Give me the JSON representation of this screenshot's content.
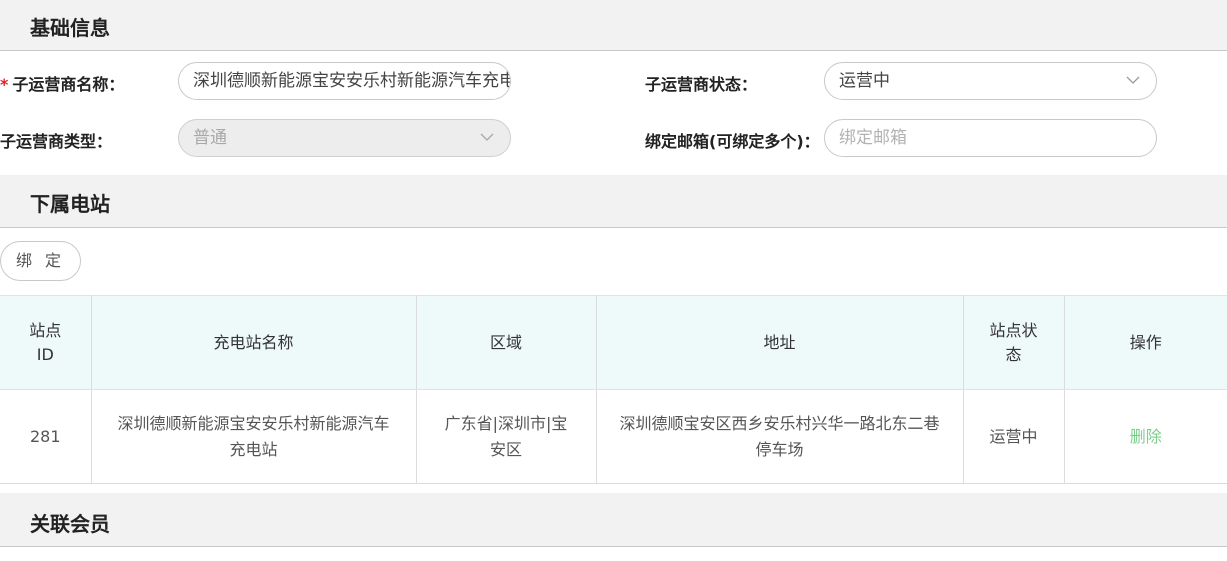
{
  "sections": {
    "basic_info": "基础信息",
    "sub_stations": "下属电站",
    "linked_members": "关联会员"
  },
  "form": {
    "required_mark": "*",
    "name_label": "子运营商名称：",
    "name_value": "深圳德顺新能源宝安安乐村新能源汽车充电站",
    "status_label": "子运营商状态：",
    "status_value": "运营中",
    "type_label": "子运营商类型：",
    "type_value": "普通",
    "email_label": "绑定邮箱(可绑定多个)：",
    "email_placeholder": "绑定邮箱"
  },
  "bind_button": "绑 定",
  "table": {
    "headers": {
      "id": "站点ID",
      "name": "充电站名称",
      "region": "区域",
      "address": "地址",
      "status": "站点状态",
      "action": "操作"
    },
    "rows": [
      {
        "id": "281",
        "name": "深圳德顺新能源宝安安乐村新能源汽车充电站",
        "region": "广东省|深圳市|宝安区",
        "address": "深圳德顺宝安区西乡安乐村兴华一路北东二巷停车场",
        "status": "运营中",
        "action": "删除"
      }
    ]
  },
  "colors": {
    "required": "#e0242a",
    "delete_link": "#7ccf8b",
    "table_header_bg": "#eef9f9",
    "section_bg": "#f2f2f2"
  }
}
